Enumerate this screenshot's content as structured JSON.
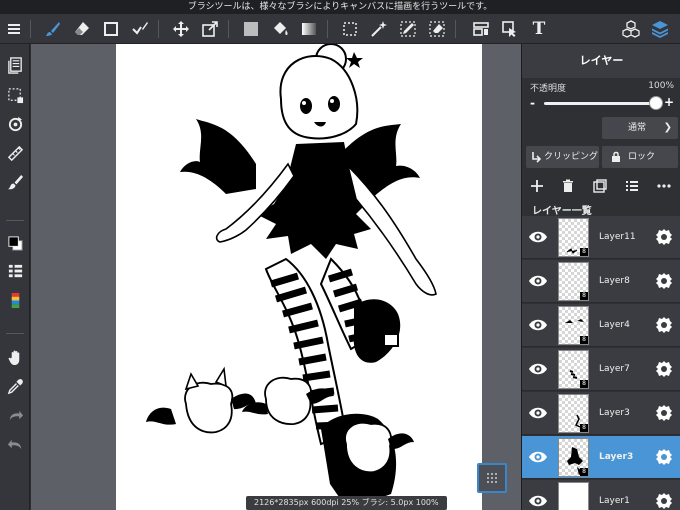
{
  "hint_text": "ブラシツールは、様々なブラシによりキャンバスに描画を行うツールです。",
  "status_text": "2126*2835px 600dpi 25% ブラシ: 5.0px 100%",
  "colors": {
    "accent": "#4a95d6",
    "toolbar": "#34363b",
    "canvas_bg": "#5d6066",
    "panel": "#2e3034"
  },
  "toolbar": {
    "icons": [
      "menu-icon",
      "brush-icon",
      "eraser-icon",
      "rect-icon",
      "check-brush-icon",
      "move-icon",
      "transform-icon",
      "fill-color-icon",
      "bucket-icon",
      "gradient-icon",
      "select-rect-icon",
      "magic-wand-icon",
      "select-pen-icon",
      "select-eraser-icon",
      "layer-move-icon",
      "operation-icon",
      "text-icon",
      "materials-icon",
      "layers-icon"
    ],
    "text_tool_glyph": "T"
  },
  "left_toolbar": {
    "icons": [
      "pages-icon",
      "selection-icon",
      "rotate-icon",
      "ruler-icon",
      "filter-brush-icon",
      "color-swatch-icon",
      "brush-list-icon",
      "palette-icon",
      "hand-icon",
      "eyedropper-icon",
      "redo-icon",
      "undo-icon"
    ]
  },
  "panel": {
    "title": "レイヤー",
    "opacity_label": "不透明度",
    "opacity_value": "100%",
    "opacity_fraction": 1.0,
    "minus": "-",
    "plus": "+",
    "blend_mode": "通常",
    "clipping_label": "クリッピング",
    "lock_label": "ロック",
    "list_header": "レイヤー一覧"
  },
  "layers": [
    {
      "name": "Layer11",
      "bits": "8",
      "active": false,
      "white": false
    },
    {
      "name": "Layer8",
      "bits": "8",
      "active": false,
      "white": false
    },
    {
      "name": "Layer4",
      "bits": "8",
      "active": false,
      "white": false
    },
    {
      "name": "Layer7",
      "bits": "8",
      "active": false,
      "white": false
    },
    {
      "name": "Layer3",
      "bits": "8",
      "active": false,
      "white": false
    },
    {
      "name": "Layer3",
      "bits": "8",
      "active": true,
      "white": false
    },
    {
      "name": "Layer1",
      "bits": "8",
      "active": false,
      "white": true
    }
  ]
}
